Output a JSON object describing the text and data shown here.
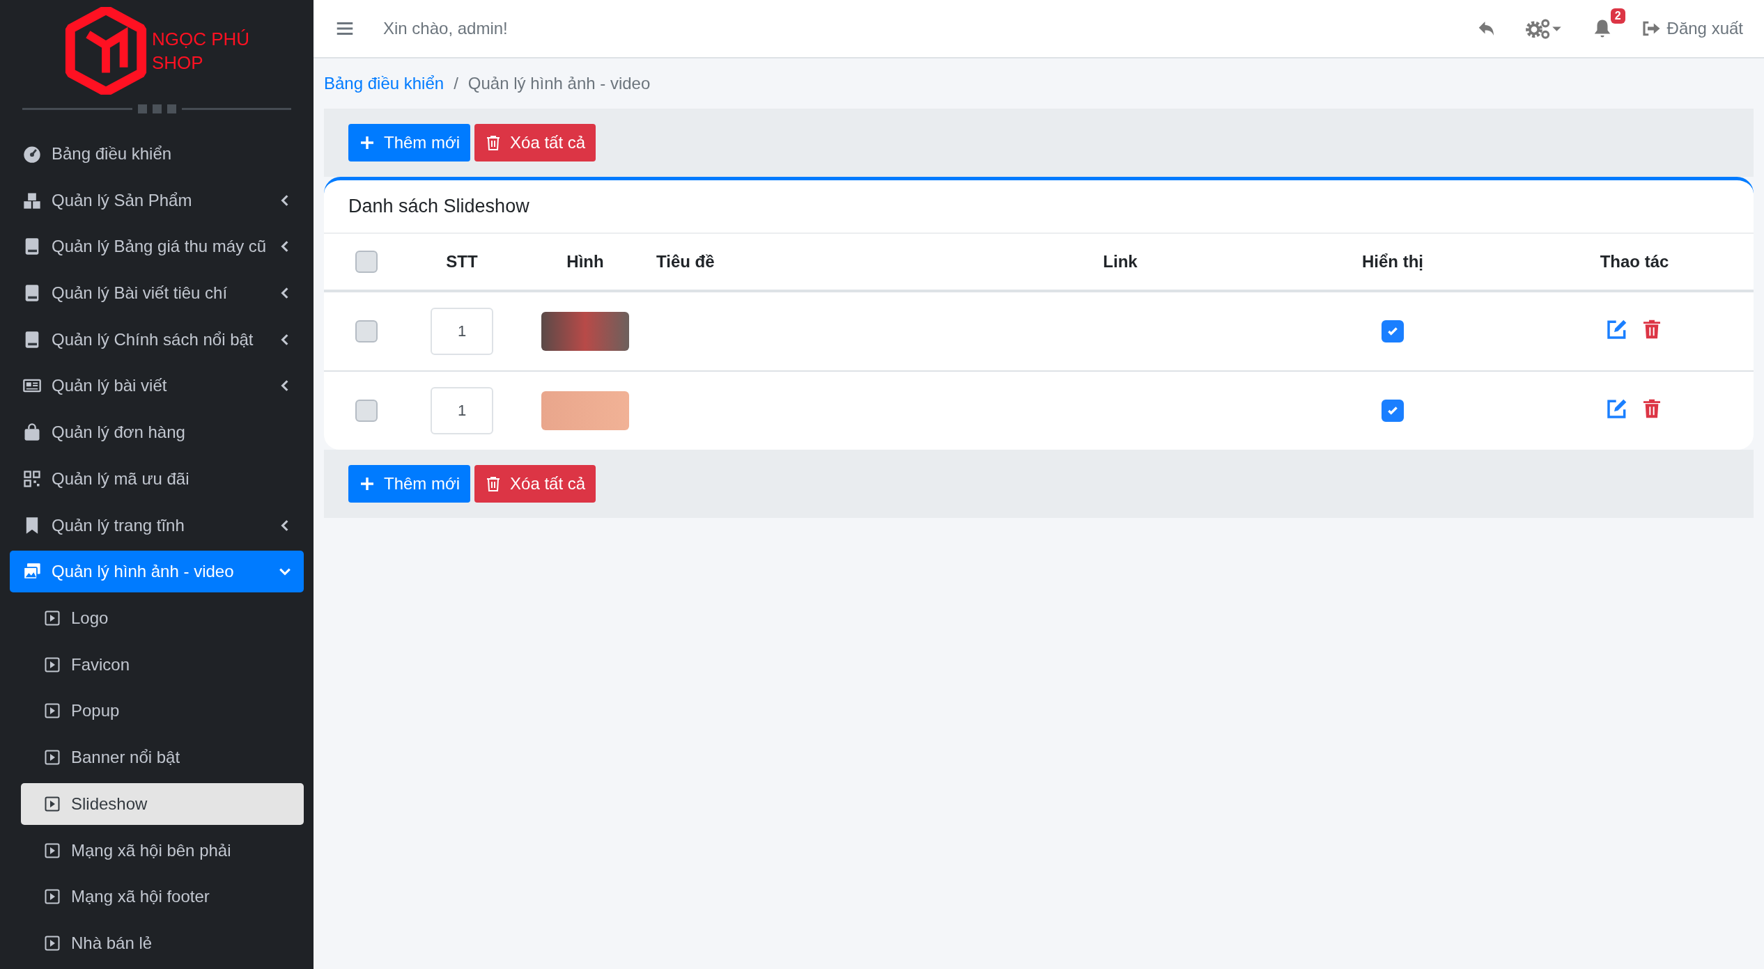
{
  "brand": {
    "line1": "NGỌC PHÚ",
    "line2": "SHOP"
  },
  "sidebar": {
    "items": [
      {
        "label": "Bảng điều khiển",
        "selected": false
      },
      {
        "label": "Quản lý Sản Phẩm",
        "expanded": false,
        "selected": false
      },
      {
        "label": "Quản lý Bảng giá thu máy cũ",
        "expanded": false,
        "selected": false
      },
      {
        "label": "Quản lý Bài viết tiêu chí",
        "expanded": false,
        "selected": false
      },
      {
        "label": "Quản lý Chính sách nổi bật",
        "expanded": false,
        "selected": false
      },
      {
        "label": "Quản lý bài viết",
        "expanded": false,
        "selected": false
      },
      {
        "label": "Quản lý đơn hàng",
        "selected": false
      },
      {
        "label": "Quản lý mã ưu đãi",
        "selected": false
      },
      {
        "label": "Quản lý trang tĩnh",
        "expanded": false,
        "selected": false
      },
      {
        "label": "Quản lý hình ảnh - video",
        "expanded": true,
        "selected": true,
        "children": [
          {
            "label": "Logo",
            "selected": false
          },
          {
            "label": "Favicon",
            "selected": false
          },
          {
            "label": "Popup",
            "selected": false
          },
          {
            "label": "Banner nổi bật",
            "selected": false
          },
          {
            "label": "Slideshow",
            "selected": true
          },
          {
            "label": "Mạng xã hội bên phải",
            "selected": false
          },
          {
            "label": "Mạng xã hội footer",
            "selected": false
          },
          {
            "label": "Nhà bán lẻ",
            "selected": false
          }
        ]
      }
    ]
  },
  "topbar": {
    "greeting": "Xin chào, admin!",
    "notification_count": "2",
    "logout": "Đăng xuất"
  },
  "breadcrumb": [
    {
      "label": "Bảng điều khiển",
      "kind": "link"
    },
    {
      "label": "/",
      "kind": "separator"
    },
    {
      "label": "Quản lý hình ảnh - video",
      "kind": "current"
    }
  ],
  "actions": {
    "add": "Thêm mới",
    "delete_all": "Xóa tất cả"
  },
  "card": {
    "title": "Danh sách Slideshow"
  },
  "table": {
    "select_all_checked": false,
    "columns": [
      "STT",
      "Hình",
      "Tiêu đề",
      "Link",
      "Hiển thị",
      "Thao tác"
    ],
    "rows": [
      {
        "checked": false,
        "order": "1",
        "visible": true
      },
      {
        "checked": false,
        "order": "1",
        "visible": true
      }
    ]
  },
  "bottom_actions": {
    "add": "Thêm mới",
    "delete_all": "Xóa tất cả"
  }
}
